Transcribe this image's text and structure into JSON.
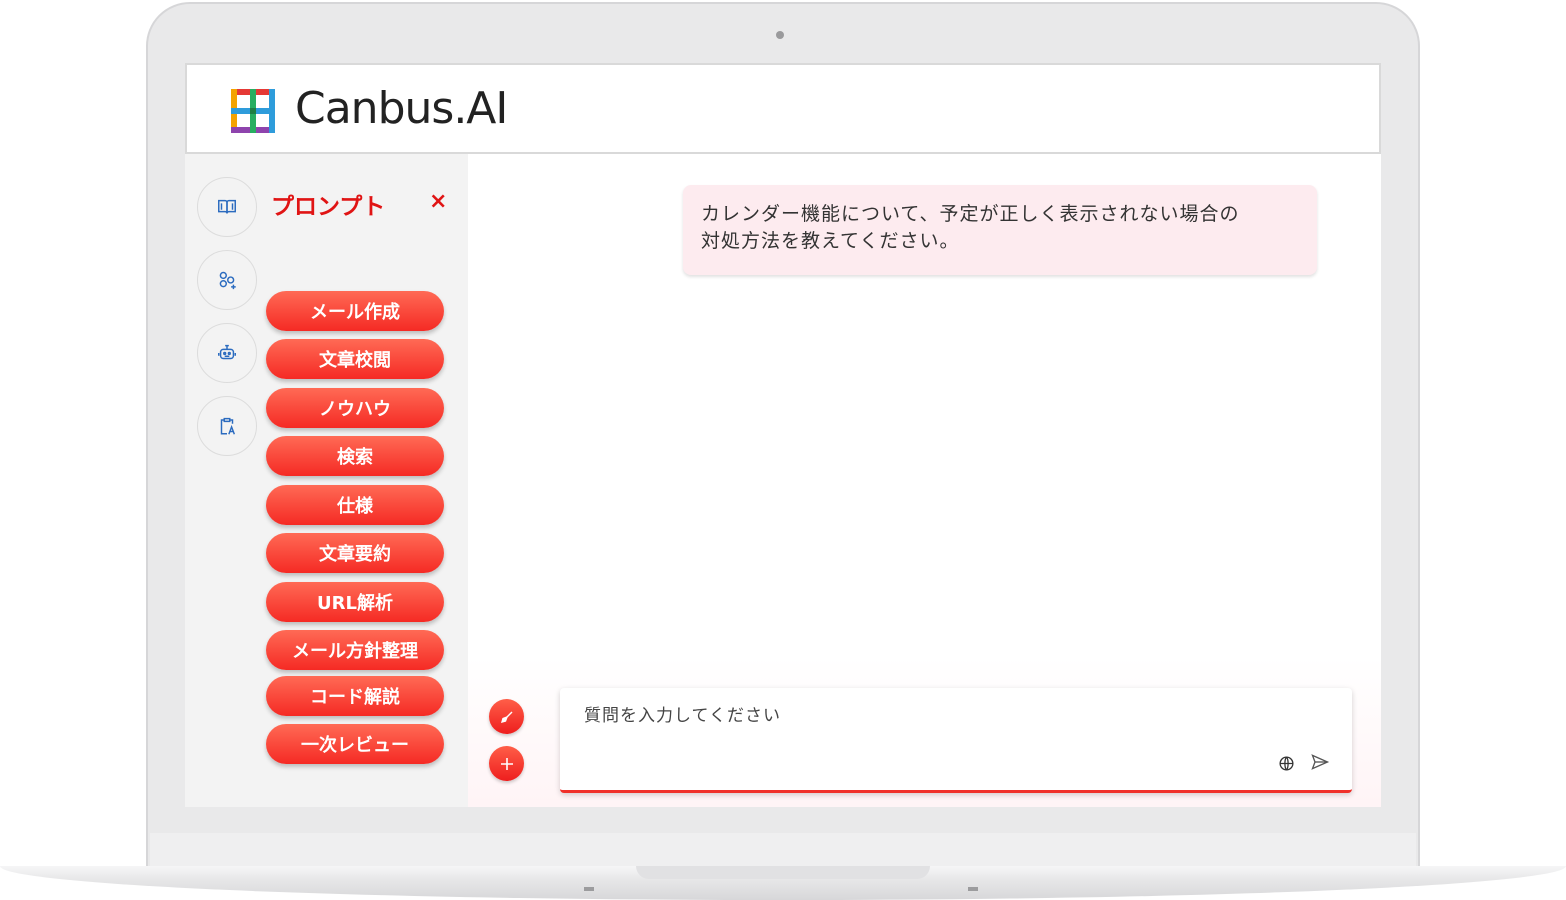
{
  "app": {
    "logo_text": "Canbus.AI",
    "brand_colors": {
      "accent": "#f52a24",
      "bubble": "#fdebef"
    }
  },
  "sidebar": {
    "rail_icons": [
      "book-icon",
      "team-icon",
      "bot-icon",
      "clipboard-translate-icon"
    ]
  },
  "prompts": {
    "title": "プロンプト",
    "close_symbol": "×",
    "items": [
      {
        "label": "メール作成"
      },
      {
        "label": "文章校閲"
      },
      {
        "label": "ノウハウ"
      },
      {
        "label": "検索"
      },
      {
        "label": "仕様"
      },
      {
        "label": "文章要約"
      },
      {
        "label": "URL解析"
      },
      {
        "label": "メール方針整理"
      },
      {
        "label": "コード解説"
      },
      {
        "label": "一次レビュー"
      }
    ]
  },
  "chat": {
    "messages": [
      {
        "role": "user",
        "text_line1": "カレンダー機能について、予定が正しく表示されない場合の",
        "text_line2": "対処方法を教えてください。"
      }
    ]
  },
  "composer": {
    "placeholder": "質問を入力してください",
    "value": "",
    "clear_icon": "broom-icon",
    "add_icon": "plus-icon",
    "web_icon": "globe-icon",
    "send_icon": "send-icon"
  }
}
